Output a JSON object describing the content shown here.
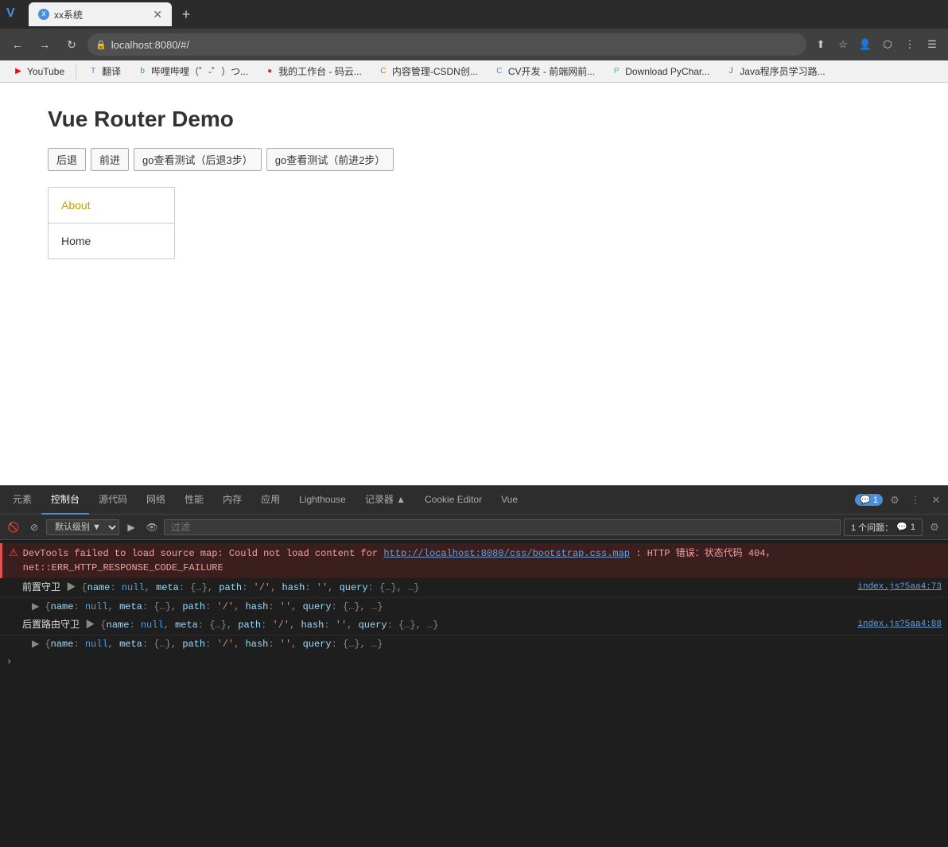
{
  "browser": {
    "tab_title": "xx系统",
    "url": "localhost:8080/#/",
    "new_tab_icon": "+"
  },
  "bookmarks": [
    {
      "label": "YouTube",
      "icon": "▶",
      "color": "#ff0000"
    },
    {
      "label": "翻译",
      "icon": "T",
      "color": "#4285f4"
    },
    {
      "label": "哔哩哔哩（゜-゜）つ...",
      "icon": "b",
      "color": "#00a1d6"
    },
    {
      "label": "我的工作台 - 码云...",
      "icon": "●",
      "color": "#c0392b"
    },
    {
      "label": "内容管理-CSDN创...",
      "icon": "C",
      "color": "#f60"
    },
    {
      "label": "CV开发 - 前端网前...",
      "icon": "C",
      "color": "#4a90d9"
    },
    {
      "label": "Download PyChar...",
      "icon": "P",
      "color": "#21d789"
    },
    {
      "label": "Java程序员学习路...",
      "icon": "J",
      "color": "#666"
    }
  ],
  "page": {
    "title": "Vue Router Demo",
    "buttons": [
      {
        "label": "后退"
      },
      {
        "label": "前进"
      },
      {
        "label": "go查看测试（后退3步）"
      },
      {
        "label": "go查看测试（前进2步）"
      }
    ],
    "nav_links": [
      {
        "label": "About",
        "active": true
      },
      {
        "label": "Home",
        "active": false
      }
    ]
  },
  "devtools": {
    "tabs": [
      {
        "label": "元素",
        "active": false
      },
      {
        "label": "控制台",
        "active": true
      },
      {
        "label": "源代码",
        "active": false
      },
      {
        "label": "网络",
        "active": false
      },
      {
        "label": "性能",
        "active": false
      },
      {
        "label": "内存",
        "active": false
      },
      {
        "label": "应用",
        "active": false
      },
      {
        "label": "Lighthouse",
        "active": false
      },
      {
        "label": "记录器 ▲",
        "active": false
      },
      {
        "label": "Cookie Editor",
        "active": false
      },
      {
        "label": "Vue",
        "active": false
      }
    ],
    "badge_count": "1",
    "issues_label": "1 个问题：",
    "issues_count": "1",
    "toolbar": {
      "level_label": "默认级别 ▼",
      "filter_placeholder": "过滤"
    },
    "console_entries": [
      {
        "type": "error",
        "text_before": "DevTools failed to load source map: Could not load content for ",
        "link": "http://localhost:8080/css/bootstrap.css.map",
        "text_after": ": HTTP 错误：状态代码 404，net::ERR_HTTP_RESPONSE_CODE_FAILURE"
      },
      {
        "type": "log",
        "label": "前置守卫",
        "arrow": "▶",
        "code": "{name: null, meta: {…}, path: '/', hash: '', query: {…}, …}",
        "source": "index.js?5aa4:73"
      },
      {
        "type": "expand",
        "arrow": "▶",
        "code": "{name: null, meta: {…}, path: '/', hash: '', query: {…}, …}"
      },
      {
        "type": "log",
        "label": "后置路由守卫",
        "arrow": "▶",
        "code": "{name: null, meta: {…}, path: '/', hash: '', query: {…}, …}",
        "source": "index.js?5aa4:88"
      },
      {
        "type": "expand",
        "arrow": "▶",
        "code": "{name: null, meta: {…}, path: '/', hash: '', query: {…}, …}"
      }
    ]
  }
}
